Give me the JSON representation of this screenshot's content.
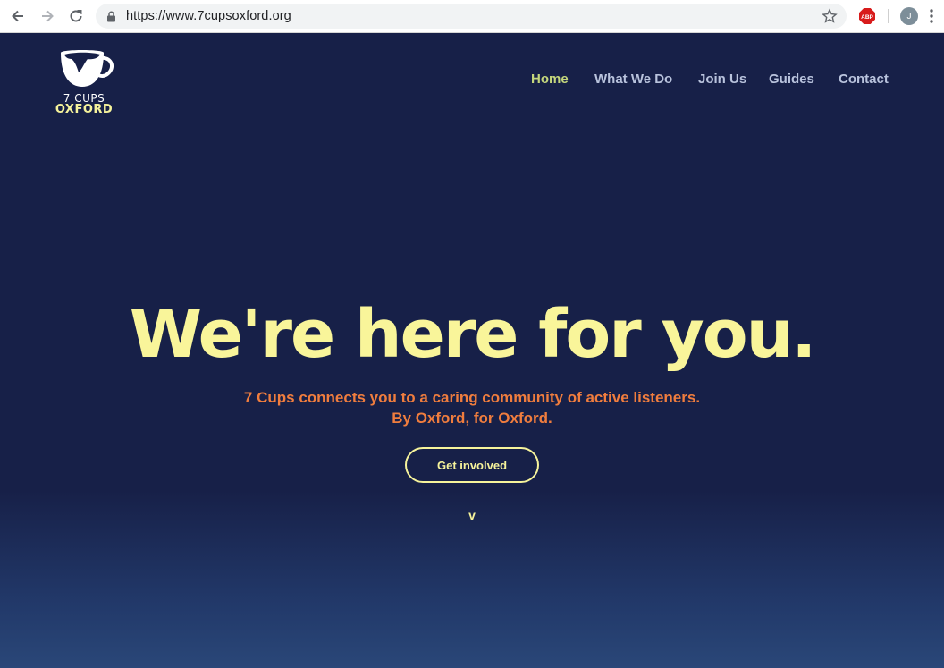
{
  "browser": {
    "url": "https://www.7cupsoxford.org",
    "avatar_initial": "J",
    "adblock_label": "ABP"
  },
  "logo": {
    "line1": "7 CUPS",
    "line2": "OXFORD"
  },
  "nav": {
    "items": [
      {
        "label": "Home",
        "active": true
      },
      {
        "label": "What We Do"
      },
      {
        "label": "Join Us"
      },
      {
        "label": "Guides"
      },
      {
        "label": "Contact"
      }
    ]
  },
  "hero": {
    "title": "We're here for you.",
    "subtitle_line1": "7 Cups connects you to a caring community of active listeners.",
    "subtitle_line2": "By Oxford, for Oxford.",
    "cta_label": "Get involved",
    "scroll_hint": "v"
  },
  "colors": {
    "background": "#172048",
    "title": "#f9f59a",
    "subtitle": "#f07d3e",
    "nav_active": "#c4d67c",
    "nav": "#b9c3dd"
  }
}
